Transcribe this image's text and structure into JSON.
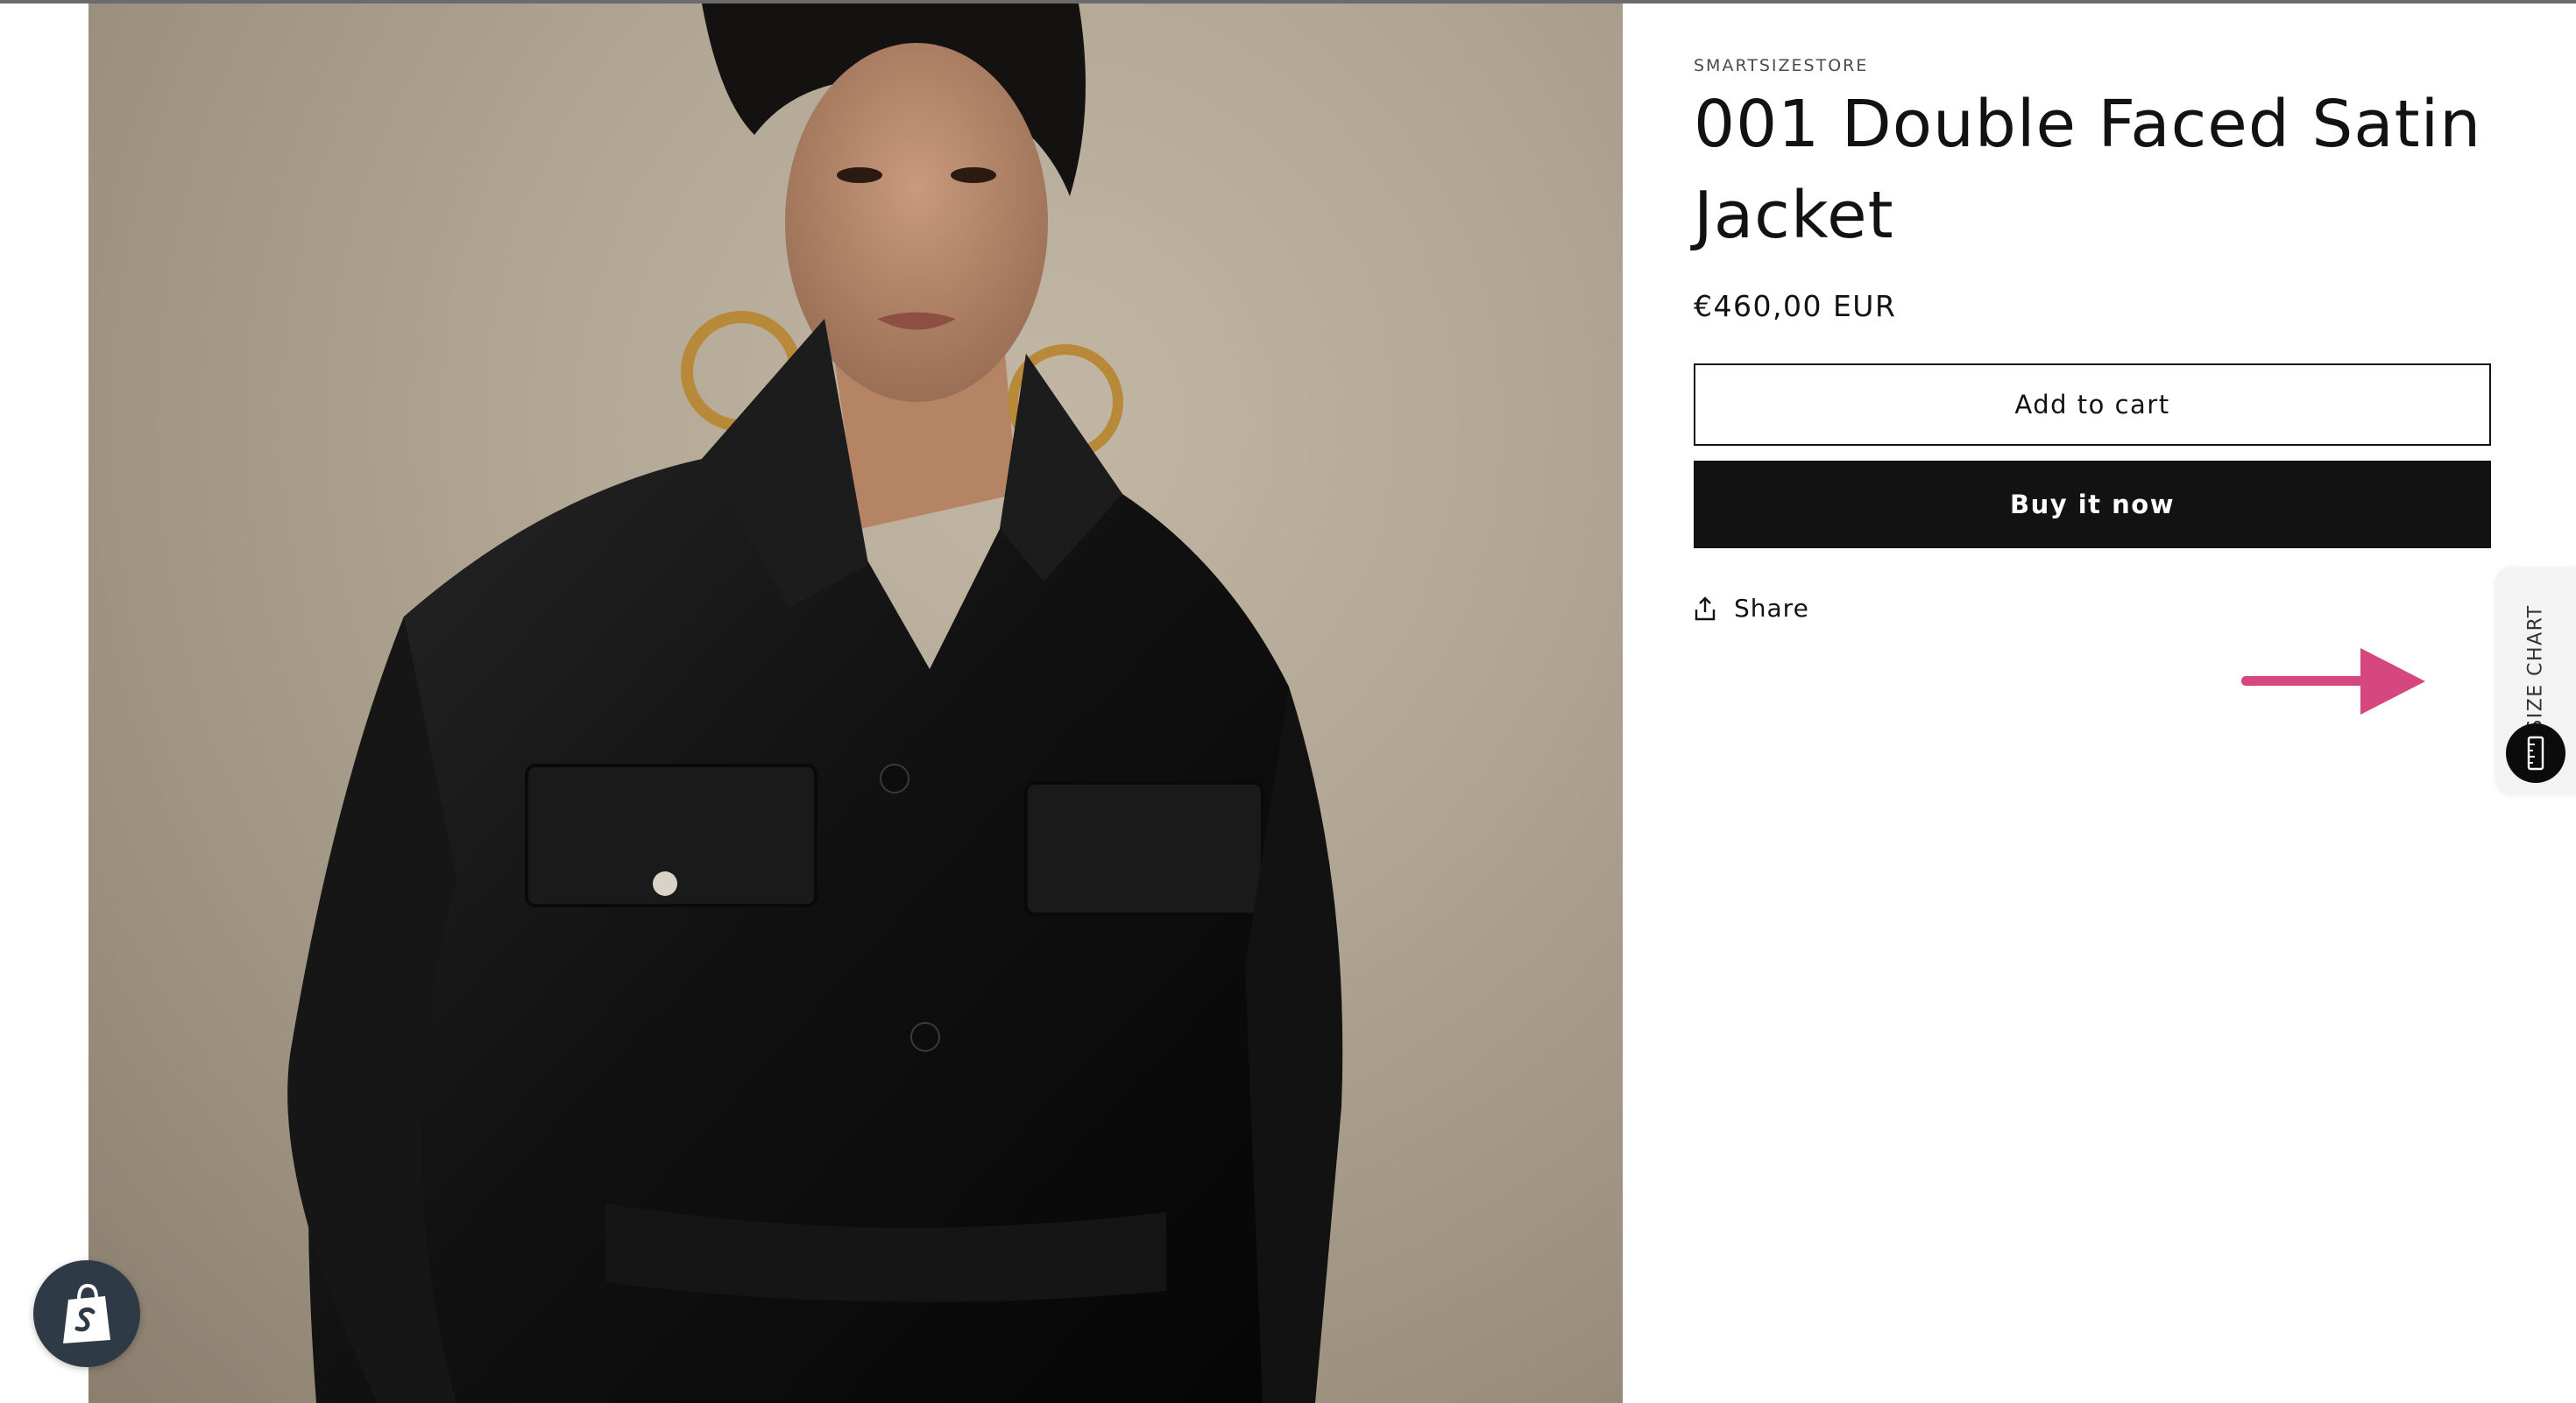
{
  "product": {
    "vendor": "SMARTSIZESTORE",
    "title": "001 Double Faced Satin Jacket",
    "price": "€460,00 EUR",
    "image_alt": "Model wearing black satin jacket with gold hoop earrings"
  },
  "actions": {
    "add_to_cart_label": "Add to cart",
    "buy_now_label": "Buy it now",
    "share_label": "Share"
  },
  "size_chart": {
    "label": "SIZE CHART",
    "icon": "ruler-icon"
  },
  "annotation": {
    "arrow_color": "#d6477f"
  },
  "badges": {
    "shopify_icon": "shopify-bag-icon",
    "shopify_color": "#2e3a45"
  },
  "colors": {
    "text": "#121212",
    "button_dark": "#121212",
    "background": "#ffffff"
  }
}
